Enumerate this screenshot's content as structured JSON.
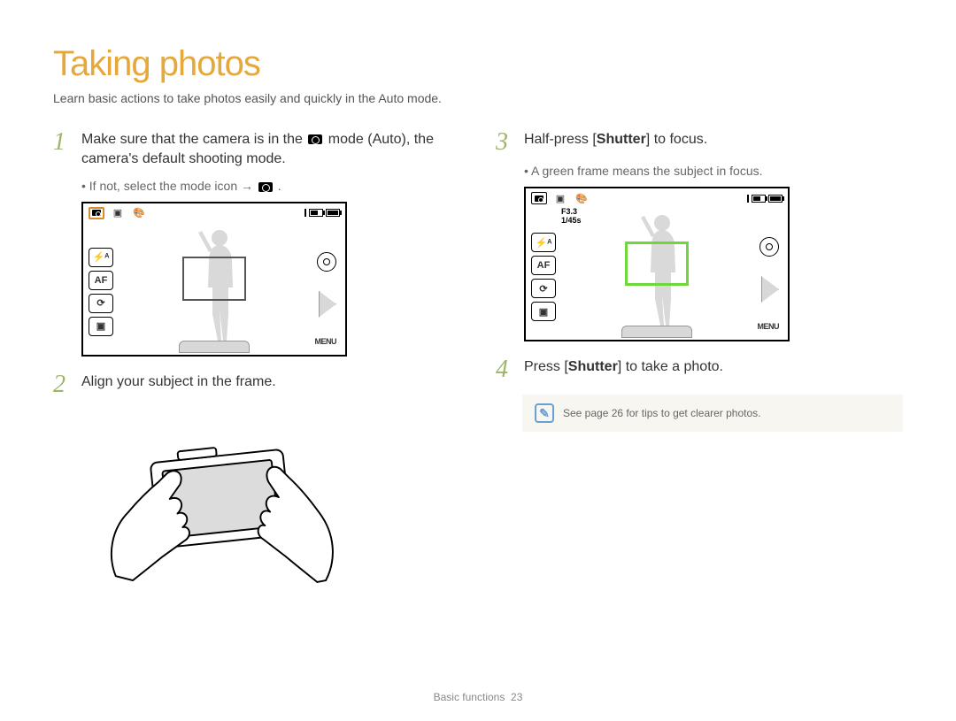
{
  "title": "Taking photos",
  "subtitle": "Learn basic actions to take photos easily and quickly in the Auto mode.",
  "step1": {
    "num": "1",
    "text_before": "Make sure that the camera is in the ",
    "text_mid": " mode (Auto), the camera's default shooting mode.",
    "sub_before": "If not, select the mode icon → ",
    "sub_after": "."
  },
  "lcd1": {
    "side_buttons": [
      "⚡ᴬ",
      "AF",
      "⟳",
      "▣"
    ],
    "menu_label": "MENU",
    "top_right_count": ""
  },
  "step2": {
    "num": "2",
    "text": "Align your subject in the frame."
  },
  "step3": {
    "num": "3",
    "text_before": "Half-press [",
    "bold": "Shutter",
    "text_after": "] to focus.",
    "sub": "A green frame means the subject in focus."
  },
  "lcd2": {
    "side_buttons": [
      "⚡ᴬ",
      "AF",
      "⟳",
      "▣"
    ],
    "menu_label": "MENU",
    "exposure_f": "F3.3",
    "exposure_s": "1/45s"
  },
  "step4": {
    "num": "4",
    "text_before": "Press [",
    "bold": "Shutter",
    "text_after": "] to take a photo."
  },
  "note": {
    "icon_glyph": "✎",
    "text": "See page 26 for tips to get clearer photos."
  },
  "footer": {
    "section": "Basic functions",
    "page": "23"
  }
}
